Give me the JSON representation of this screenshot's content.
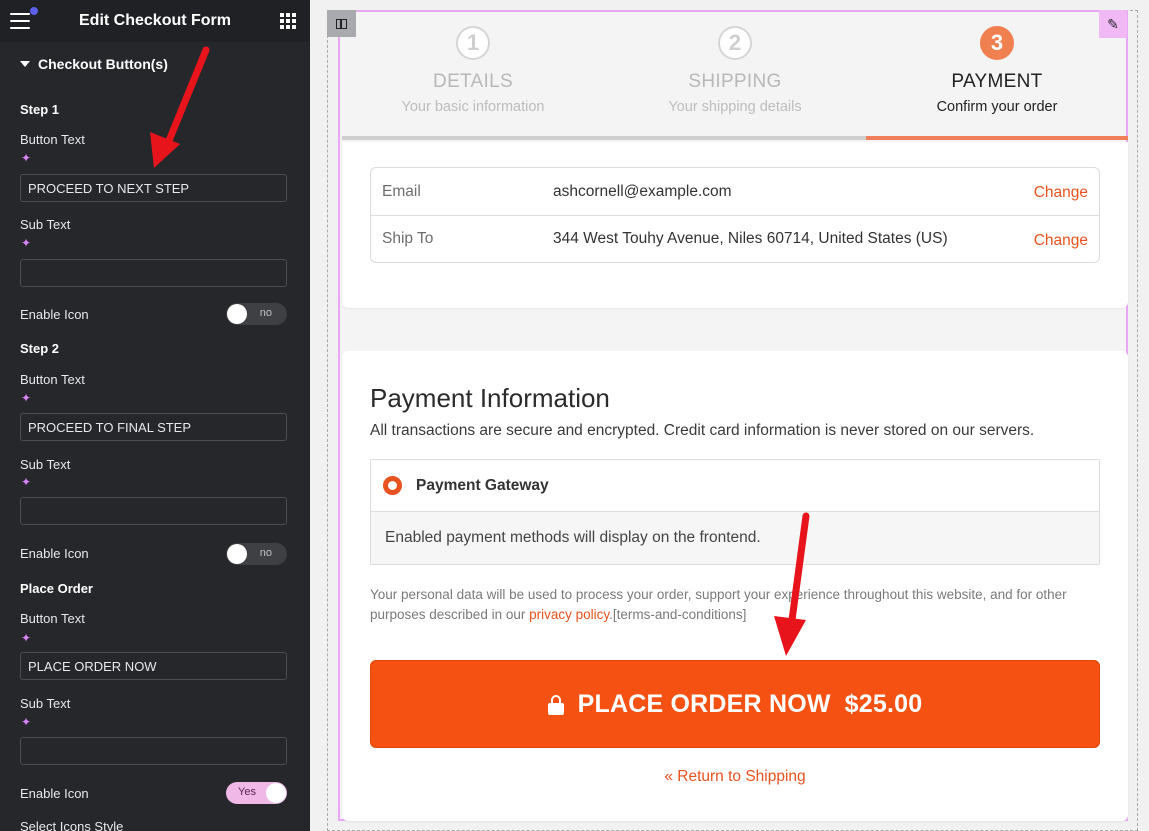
{
  "sidebar": {
    "title": "Edit Checkout Form",
    "section_title": "Checkout Button(s)",
    "step1": {
      "label": "Step 1",
      "button_text_label": "Button Text",
      "button_text_value": "PROCEED TO NEXT STEP",
      "sub_text_label": "Sub Text",
      "sub_text_value": "",
      "enable_icon_label": "Enable Icon",
      "enable_icon_state": "no"
    },
    "step2": {
      "label": "Step 2",
      "button_text_label": "Button Text",
      "button_text_value": "PROCEED TO FINAL STEP",
      "sub_text_label": "Sub Text",
      "sub_text_value": "",
      "enable_icon_label": "Enable Icon",
      "enable_icon_state": "no"
    },
    "place_order": {
      "label": "Place Order",
      "button_text_label": "Button Text",
      "button_text_value": "PLACE ORDER NOW",
      "sub_text_label": "Sub Text",
      "sub_text_value": "",
      "enable_icon_label": "Enable Icon",
      "enable_icon_state": "Yes",
      "select_icons_style_label": "Select Icons Style"
    },
    "collapse_icon": "‹"
  },
  "steps": [
    {
      "number": "1",
      "title": "DETAILS",
      "subtitle": "Your basic information"
    },
    {
      "number": "2",
      "title": "SHIPPING",
      "subtitle": "Your shipping details"
    },
    {
      "number": "3",
      "title": "PAYMENT",
      "subtitle": "Confirm your order"
    }
  ],
  "summary": {
    "email_label": "Email",
    "email_value": "ashcornell@example.com",
    "ship_label": "Ship To",
    "ship_value": "344 West Touhy Avenue, Niles 60714, United States (US)",
    "change_label": "Change"
  },
  "payment": {
    "title": "Payment Information",
    "description": "All transactions are secure and encrypted. Credit card information is never stored on our servers.",
    "gateway_name": "Payment Gateway",
    "gateway_message": "Enabled payment methods will display on the frontend.",
    "privacy_text_before": "Your personal data will be used to process your order, support your experience throughout this website, and for other purposes described in our ",
    "privacy_link": "privacy policy",
    "privacy_text_after": ".[terms-and-conditions]",
    "button_label": "PLACE ORDER NOW",
    "button_price": "$25.00",
    "return_link": "« Return to Shipping"
  },
  "colors": {
    "accent": "#f45112",
    "step_active": "#f08050",
    "sidebar_bg": "#26272b",
    "widget_outline": "#e9a7f5",
    "annotation_arrow": "#e8141b"
  },
  "icons": {
    "menu": "hamburger-menu-icon",
    "apps": "grid-icon",
    "ai": "sparkle-icon",
    "lock": "lock-icon",
    "edit": "pencil-icon",
    "column": "column-layout-icon"
  }
}
